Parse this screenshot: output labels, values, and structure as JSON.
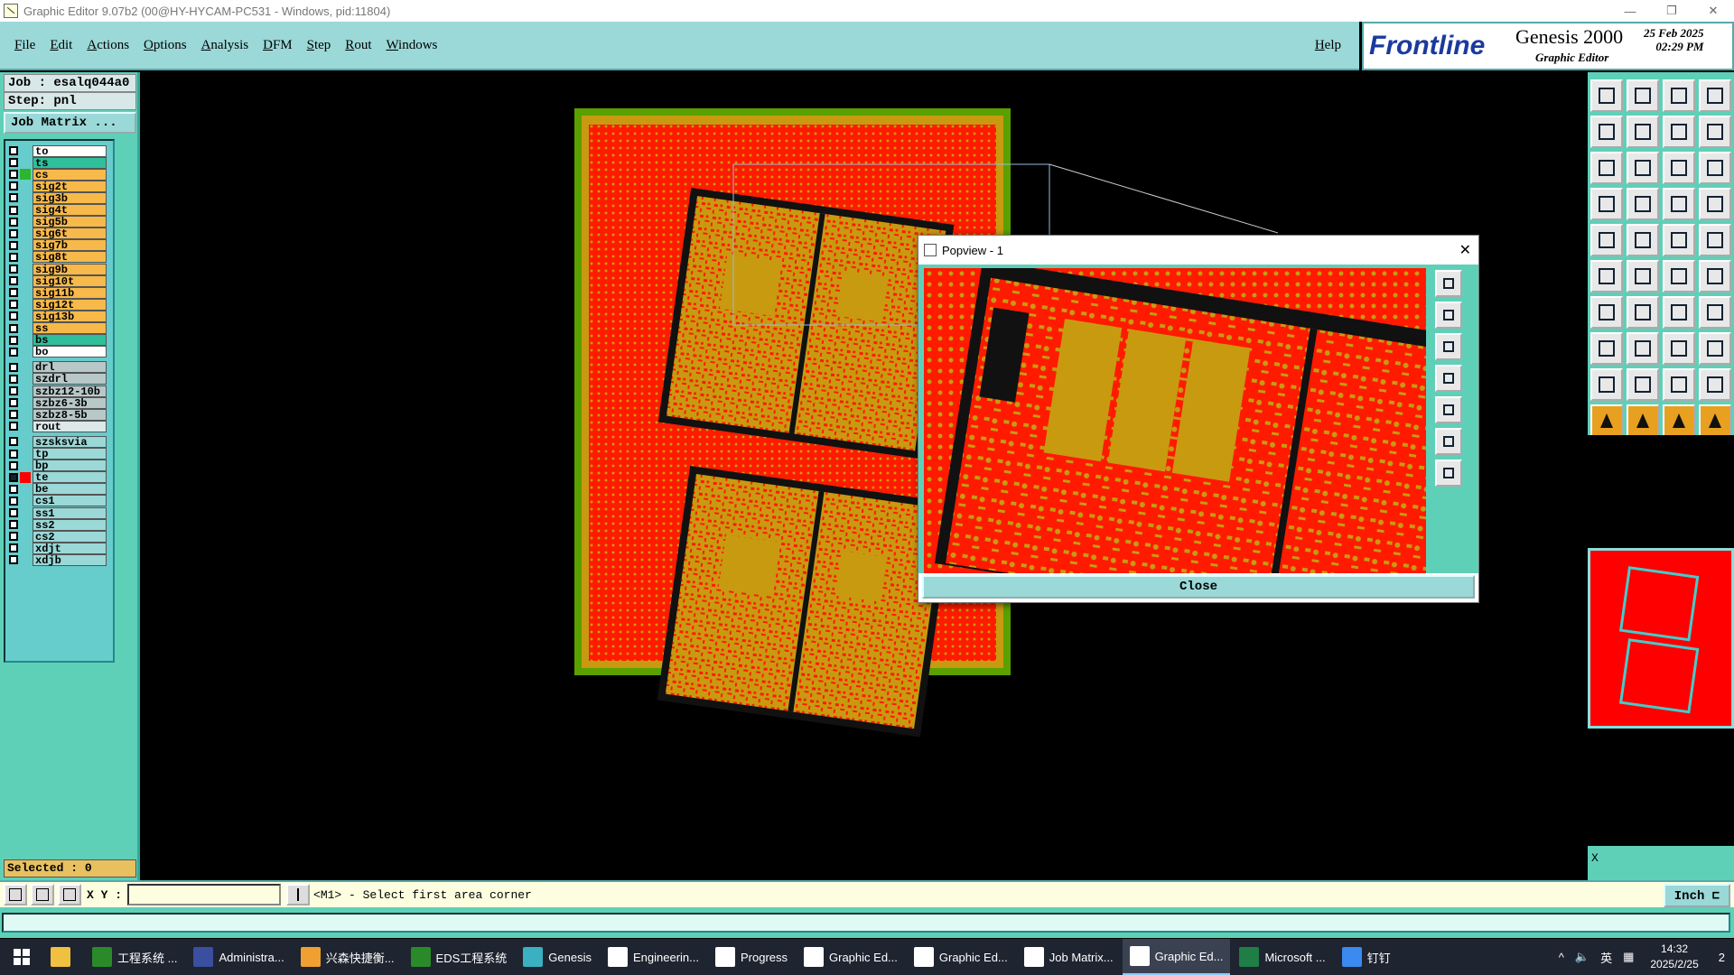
{
  "window": {
    "title": "Graphic Editor 9.07b2 (00@HY-HYCAM-PC531 - Windows, pid:11804)",
    "minimize": "—",
    "restore": "❐",
    "close": "✕"
  },
  "menu": [
    "File",
    "Edit",
    "Actions",
    "Options",
    "Analysis",
    "DFM",
    "Step",
    "Rout",
    "Windows"
  ],
  "help": "Help",
  "logo": {
    "brand": "Frontline",
    "product": "Genesis 2000",
    "subtitle": "Graphic Editor",
    "date": "25 Feb 2025",
    "time": "02:29 PM"
  },
  "job": {
    "job_label": "Job : esalq044a0",
    "step_label": "Step: pnl",
    "matrix_button": "Job Matrix ..."
  },
  "layers": [
    {
      "name": "to",
      "bg": "#ffffff",
      "swatch": ""
    },
    {
      "name": "ts",
      "bg": "#2fbf9a",
      "swatch": ""
    },
    {
      "name": "cs",
      "bg": "#f6b94a",
      "swatch": "#2db52d"
    },
    {
      "name": "sig2t",
      "bg": "#f6b94a",
      "swatch": ""
    },
    {
      "name": "sig3b",
      "bg": "#f6b94a",
      "swatch": ""
    },
    {
      "name": "sig4t",
      "bg": "#f6b94a",
      "swatch": ""
    },
    {
      "name": "sig5b",
      "bg": "#f6b94a",
      "swatch": ""
    },
    {
      "name": "sig6t",
      "bg": "#f6b94a",
      "swatch": ""
    },
    {
      "name": "sig7b",
      "bg": "#f6b94a",
      "swatch": ""
    },
    {
      "name": "sig8t",
      "bg": "#f6b94a",
      "swatch": ""
    },
    {
      "name": "sig9b",
      "bg": "#f6b94a",
      "swatch": ""
    },
    {
      "name": "sig10t",
      "bg": "#f6b94a",
      "swatch": ""
    },
    {
      "name": "sig11b",
      "bg": "#f6b94a",
      "swatch": ""
    },
    {
      "name": "sig12t",
      "bg": "#f6b94a",
      "swatch": ""
    },
    {
      "name": "sig13b",
      "bg": "#f6b94a",
      "swatch": ""
    },
    {
      "name": "ss",
      "bg": "#f6b94a",
      "swatch": ""
    },
    {
      "name": "bs",
      "bg": "#2fbf9a",
      "swatch": ""
    },
    {
      "name": "bo",
      "bg": "#ffffff",
      "swatch": ""
    },
    {
      "name": "drl",
      "bg": "#b8c8c8",
      "swatch": "",
      "gap": true
    },
    {
      "name": "szdrl",
      "bg": "#b8c8c8",
      "swatch": ""
    },
    {
      "name": "szbz12-10b",
      "bg": "#b8c8c8",
      "swatch": ""
    },
    {
      "name": "szbz6-3b",
      "bg": "#b8c8c8",
      "swatch": ""
    },
    {
      "name": "szbz8-5b",
      "bg": "#b8c8c8",
      "swatch": ""
    },
    {
      "name": "rout",
      "bg": "#dde8e8",
      "swatch": ""
    },
    {
      "name": "szsksvia",
      "bg": "#9bd8d8",
      "swatch": "",
      "gap": true
    },
    {
      "name": "tp",
      "bg": "#9bd8d8",
      "swatch": ""
    },
    {
      "name": "bp",
      "bg": "#9bd8d8",
      "swatch": ""
    },
    {
      "name": "te",
      "bg": "#9bd8d8",
      "swatch": "#ff0000",
      "checked": true
    },
    {
      "name": "be",
      "bg": "#9bd8d8",
      "swatch": ""
    },
    {
      "name": "cs1",
      "bg": "#9bd8d8",
      "swatch": ""
    },
    {
      "name": "ss1",
      "bg": "#9bd8d8",
      "swatch": ""
    },
    {
      "name": "ss2",
      "bg": "#9bd8d8",
      "swatch": ""
    },
    {
      "name": "cs2",
      "bg": "#9bd8d8",
      "swatch": ""
    },
    {
      "name": "xdjt",
      "bg": "#9bd8d8",
      "swatch": ""
    },
    {
      "name": "xdjb",
      "bg": "#9bd8d8",
      "swatch": ""
    }
  ],
  "selected": "Selected : 0",
  "status": {
    "xy_label": "X Y :",
    "xy_value": "",
    "prompt": "<M1> - Select first area corner",
    "units": "Inch ⊏"
  },
  "right": {
    "x_label": "X"
  },
  "popview": {
    "title": "Popview - 1",
    "close_label": "Close"
  },
  "taskbar": {
    "items": [
      "工程系统 ...",
      "Administra...",
      "兴森快捷衡...",
      "EDS工程系统",
      "Genesis",
      "Engineerin...",
      "Progress",
      "Graphic Ed...",
      "Graphic Ed...",
      "Job Matrix...",
      "Graphic Ed...",
      "Microsoft ...",
      "钉钉"
    ],
    "active_index": 10,
    "time": "14:32",
    "date": "2025/2/25",
    "ime": "英",
    "notify": "2"
  },
  "colors": {
    "panel": "#5fd0b8",
    "menubar": "#9bd8d8",
    "board_red": "#ff1a00",
    "copper": "#c89a10",
    "border_green": "#5aa000"
  }
}
